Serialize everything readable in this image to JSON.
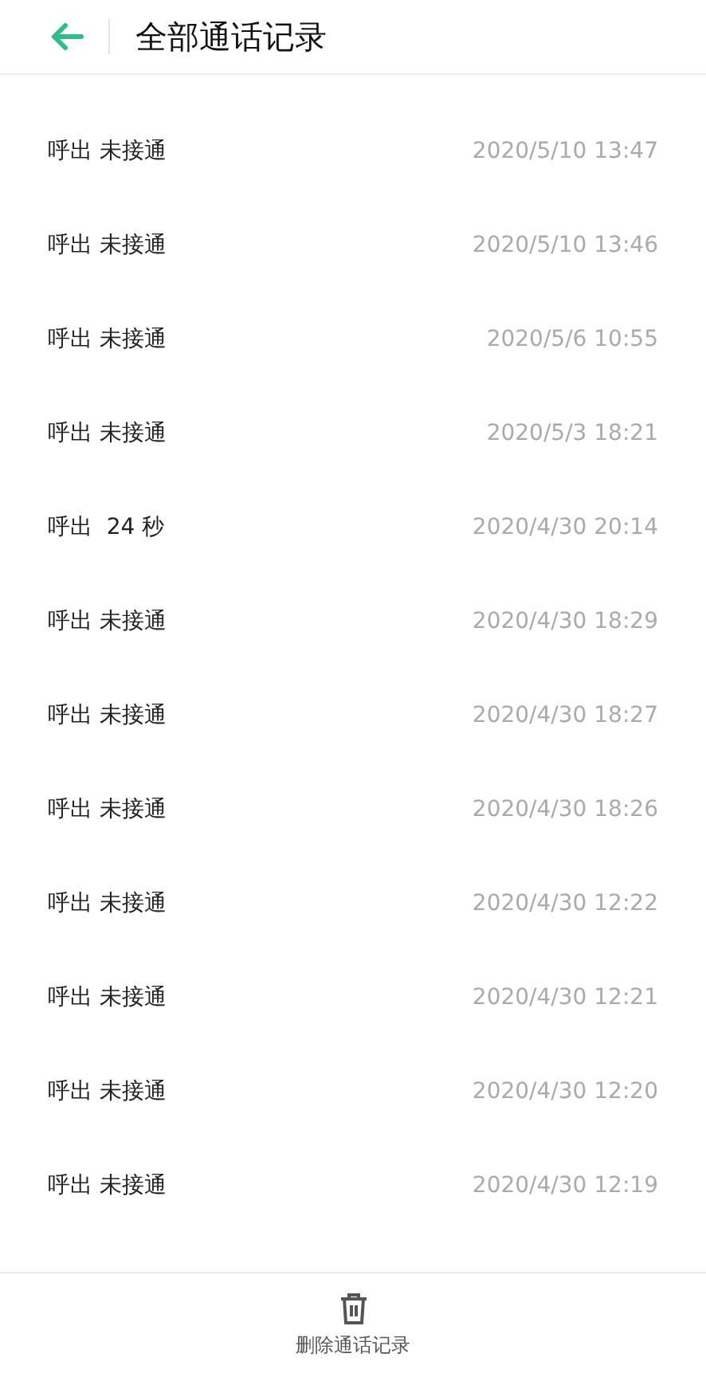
{
  "header": {
    "title": "全部通话记录"
  },
  "calls": [
    {
      "status": "呼出 未接通",
      "time": "2020/5/10 13:47"
    },
    {
      "status": "呼出 未接通",
      "time": "2020/5/10 13:46"
    },
    {
      "status": "呼出 未接通",
      "time": "2020/5/6 10:55"
    },
    {
      "status": "呼出 未接通",
      "time": "2020/5/3 18:21"
    },
    {
      "status": "呼出  24 秒",
      "time": "2020/4/30 20:14"
    },
    {
      "status": "呼出 未接通",
      "time": "2020/4/30 18:29"
    },
    {
      "status": "呼出 未接通",
      "time": "2020/4/30 18:27"
    },
    {
      "status": "呼出 未接通",
      "time": "2020/4/30 18:26"
    },
    {
      "status": "呼出 未接通",
      "time": "2020/4/30 12:22"
    },
    {
      "status": "呼出 未接通",
      "time": "2020/4/30 12:21"
    },
    {
      "status": "呼出 未接通",
      "time": "2020/4/30 12:20"
    },
    {
      "status": "呼出 未接通",
      "time": "2020/4/30 12:19"
    }
  ],
  "bottom_bar": {
    "label": "删除通话记录"
  }
}
